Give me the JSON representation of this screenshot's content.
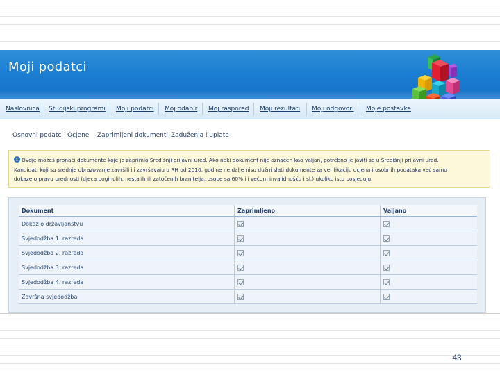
{
  "header": {
    "title": "Moji podatci"
  },
  "nav": {
    "items": [
      {
        "label": "Naslovnica"
      },
      {
        "label": "Studijski programi"
      },
      {
        "label": "Moji podatci"
      },
      {
        "label": "Moj odabir"
      },
      {
        "label": "Moj raspored"
      },
      {
        "label": "Moji rezultati"
      },
      {
        "label": "Moji odgovori"
      },
      {
        "label": "Moje postavke"
      }
    ]
  },
  "subnav": {
    "items": [
      {
        "label": "Osnovni podatci"
      },
      {
        "label": "Ocjene"
      },
      {
        "label": "Zaprimljeni dokumenti"
      },
      {
        "label": "Zaduženja i uplate"
      }
    ]
  },
  "info": {
    "lines": [
      "Ovdje možeš pronaći dokumente koje je zaprimio Središnji prijavni ured. Ako neki dokument nije označen kao valjan, potrebno je javiti se u Središnji prijavni ured.",
      "Kandidati koji su srednje obrazovanje završili ili završavaju u RH od 2010. godine ne dalje nisu dužni slati dokumente za verifikaciju ocjena i osobnih podataka već samo",
      "dokaze o pravu prednosti (djeca poginulih, nestalih ili zatočenih branitelja, osobe sa 60% ili većom invalidnošću i sl.) ukoliko isto posjeduju."
    ]
  },
  "table": {
    "columns": [
      "Dokument",
      "Zaprimljeno",
      "Valjano"
    ],
    "rows": [
      {
        "document": "Dokaz o državljanstvu",
        "received": true,
        "valid": true
      },
      {
        "document": "Svjedodžba 1. razreda",
        "received": true,
        "valid": true
      },
      {
        "document": "Svjedodžba 2. razreda",
        "received": true,
        "valid": true
      },
      {
        "document": "Svjedodžba 3. razreda",
        "received": true,
        "valid": true
      },
      {
        "document": "Svjedodžba 4. razreda",
        "received": true,
        "valid": true
      },
      {
        "document": "Završna svjedodžba",
        "received": true,
        "valid": true
      }
    ]
  },
  "footer": {
    "page_number": "43"
  },
  "colors": {
    "banner": "#1c7fd2",
    "nav_text": "#1d3e72",
    "info_bg": "#fdf8d9",
    "panel_bg": "#e6eef6"
  },
  "icons": {
    "logo": "colored-cubes-logo",
    "info": "info-icon",
    "checkbox": "checked-checkbox-icon"
  }
}
